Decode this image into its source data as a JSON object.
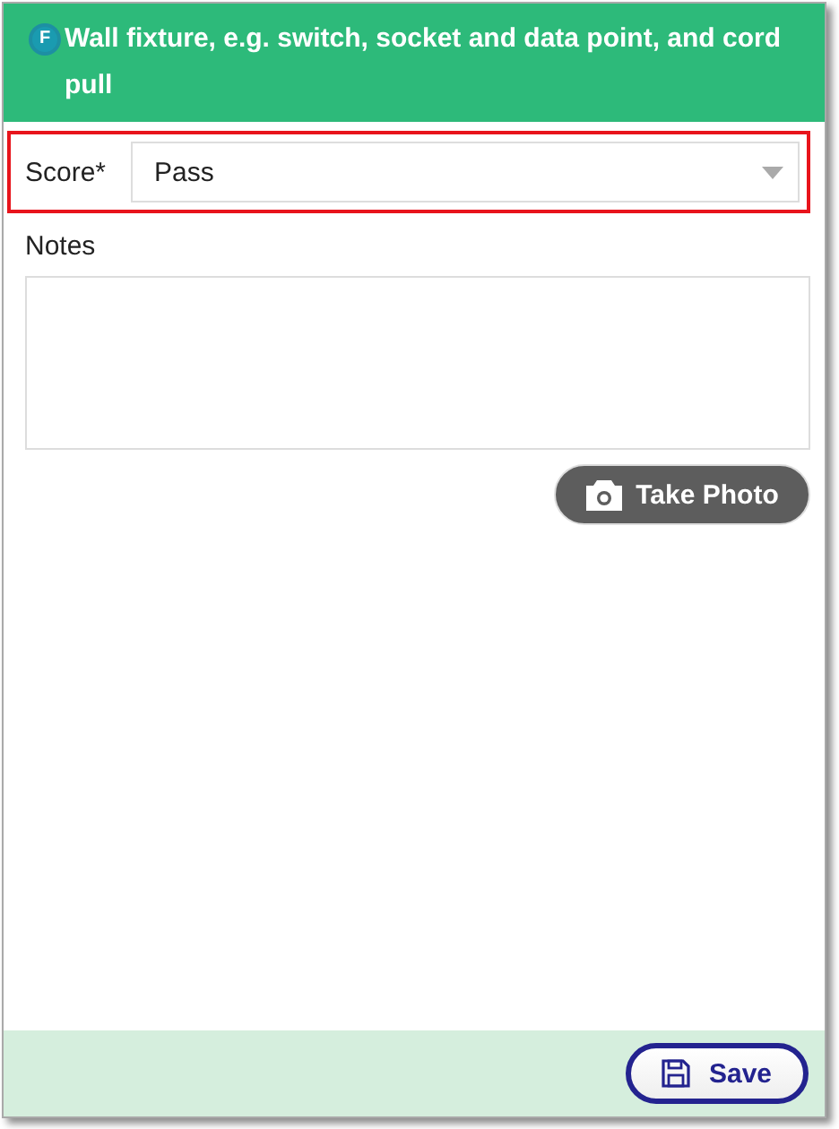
{
  "header": {
    "logo_letter": "F",
    "title": "Wall fixture, e.g. switch, socket and data point, and cord pull"
  },
  "score": {
    "label": "Score*",
    "value": "Pass",
    "highlighted": true
  },
  "notes": {
    "label": "Notes"
  },
  "photo_button": {
    "label": "Take Photo"
  },
  "save_button": {
    "label": "Save"
  }
}
